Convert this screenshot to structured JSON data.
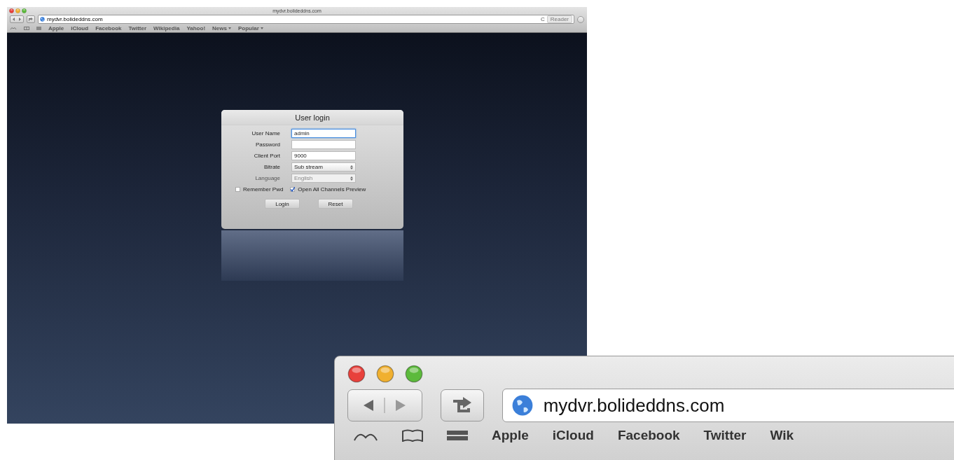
{
  "browser": {
    "title": "mydvr.bolideddns.com",
    "url": "mydvr.bolideddns.com",
    "reload": "C",
    "reader": "Reader",
    "bookmarks": [
      {
        "label": "Apple",
        "menu": false
      },
      {
        "label": "iCloud",
        "menu": false
      },
      {
        "label": "Facebook",
        "menu": false
      },
      {
        "label": "Twitter",
        "menu": false
      },
      {
        "label": "Wikipedia",
        "menu": false
      },
      {
        "label": "Yahoo!",
        "menu": false
      },
      {
        "label": "News",
        "menu": true
      },
      {
        "label": "Popular",
        "menu": true
      }
    ]
  },
  "login": {
    "title": "User login",
    "fields": [
      {
        "label": "User Name",
        "kind": "text",
        "value": "admin",
        "focused": true,
        "disabled": false
      },
      {
        "label": "Password",
        "kind": "password",
        "focused": false,
        "disabled": false
      },
      {
        "label": "Client Port",
        "kind": "text",
        "value": "9000",
        "focused": false,
        "disabled": false
      },
      {
        "label": "Bitrate",
        "kind": "select",
        "value": "Sub stream",
        "focused": false,
        "disabled": false
      },
      {
        "label": "Language",
        "kind": "select",
        "value": "English",
        "focused": false,
        "disabled": true
      }
    ],
    "checkboxes": [
      {
        "label": "Remember Pwd",
        "checked": false
      },
      {
        "label": "Open All Channels Preview",
        "checked": true
      }
    ],
    "buttons": [
      "Login",
      "Reset"
    ]
  },
  "inset": {
    "url": "mydvr.bolideddns.com",
    "bookmarks": [
      "Apple",
      "iCloud",
      "Facebook",
      "Twitter",
      "Wik"
    ]
  }
}
